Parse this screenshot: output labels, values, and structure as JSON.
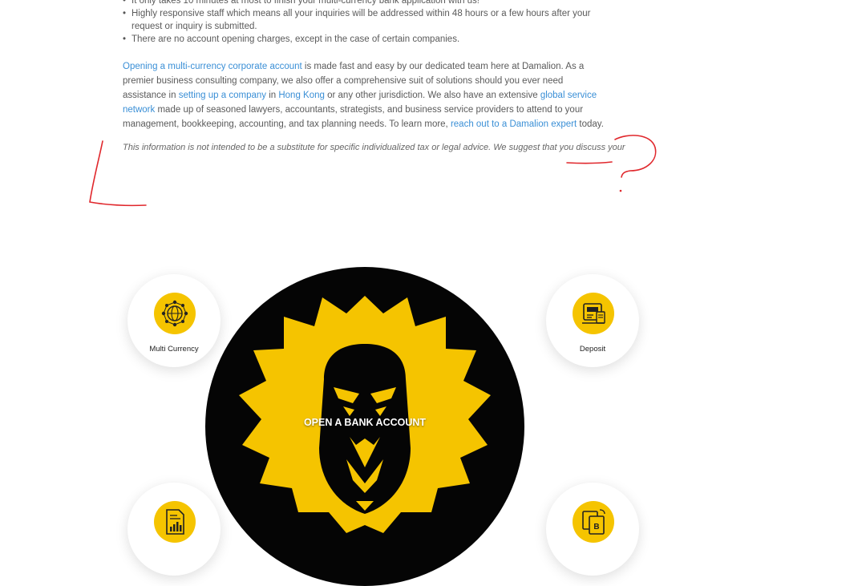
{
  "article": {
    "bullets": [
      "It only takes 10 minutes at most to finish your multi-currency bank application with us!",
      "Highly responsive staff which means all your inquiries will be addressed within 48 hours or a few hours after your request or inquiry is submitted.",
      "There are no account opening charges, except in the case of certain companies."
    ],
    "paragraph": {
      "link_opening": "Opening a multi-currency corporate account",
      "text_1": " is made fast and easy by our dedicated team here at Damalion. As a premier business consulting company, we also offer a comprehensive suit of solutions should you ever need assistance in ",
      "link_setup": "setting up a company",
      "text_2": " in ",
      "link_hk": "Hong Kong",
      "text_3": " or any other jurisdiction. We also have an extensive ",
      "link_network": "global service network",
      "text_4": " made up of seasoned lawyers, accountants, strategists, and business service providers to attend to your management, bookkeeping, accounting, and tax planning needs. To learn more, ",
      "link_expert": "reach out to a Damalion expert",
      "text_5": " today."
    },
    "disclaimer": "This information is not intended to be a substitute for specific individualized tax or legal advice. We suggest that you discuss your"
  },
  "features": {
    "multi_currency": "Multi Currency",
    "deposit": "Deposit"
  },
  "hero": {
    "cta": "OPEN A BANK ACCOUNT"
  },
  "colors": {
    "accent": "#f5c400",
    "link": "#3a8fd6",
    "annotation": "#e0272c"
  },
  "icons": [
    "globe-network-icon",
    "atm-card-icon",
    "report-document-icon",
    "exchange-document-icon",
    "lion-logo"
  ]
}
